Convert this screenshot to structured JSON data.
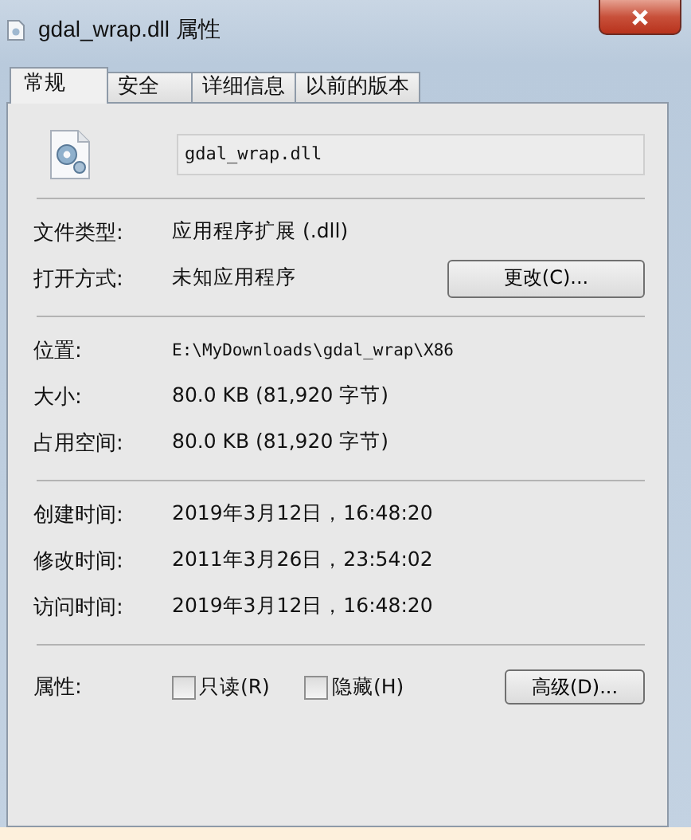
{
  "window": {
    "title": "gdal_wrap.dll 属性"
  },
  "tabs": [
    {
      "label": "常规",
      "selected": true
    },
    {
      "label": "安全",
      "selected": false
    },
    {
      "label": "详细信息",
      "selected": false
    },
    {
      "label": "以前的版本",
      "selected": false
    }
  ],
  "file": {
    "name": "gdal_wrap.dll"
  },
  "sections": [
    {
      "rows": [
        {
          "label": "文件类型:",
          "value": "应用程序扩展 (.dll)"
        },
        {
          "label": "打开方式:",
          "value": "未知应用程序",
          "button": "更改(C)..."
        }
      ]
    },
    {
      "rows": [
        {
          "label": "位置:",
          "value": "E:\\MyDownloads\\gdal_wrap\\X86",
          "mono": true
        },
        {
          "label": "大小:",
          "value": "80.0 KB (81,920 字节)"
        },
        {
          "label": "占用空间:",
          "value": "80.0 KB (81,920 字节)"
        }
      ]
    },
    {
      "rows": [
        {
          "label": "创建时间:",
          "value": "2019年3月12日，16:48:20"
        },
        {
          "label": "修改时间:",
          "value": "2011年3月26日，23:54:02"
        },
        {
          "label": "访问时间:",
          "value": "2019年3月12日，16:48:20"
        }
      ]
    }
  ],
  "attributes": {
    "label": "属性:",
    "checkboxes": [
      {
        "label": "只读(R)",
        "checked": false
      },
      {
        "label": "隐藏(H)",
        "checked": false
      }
    ],
    "button": "高级(D)..."
  }
}
